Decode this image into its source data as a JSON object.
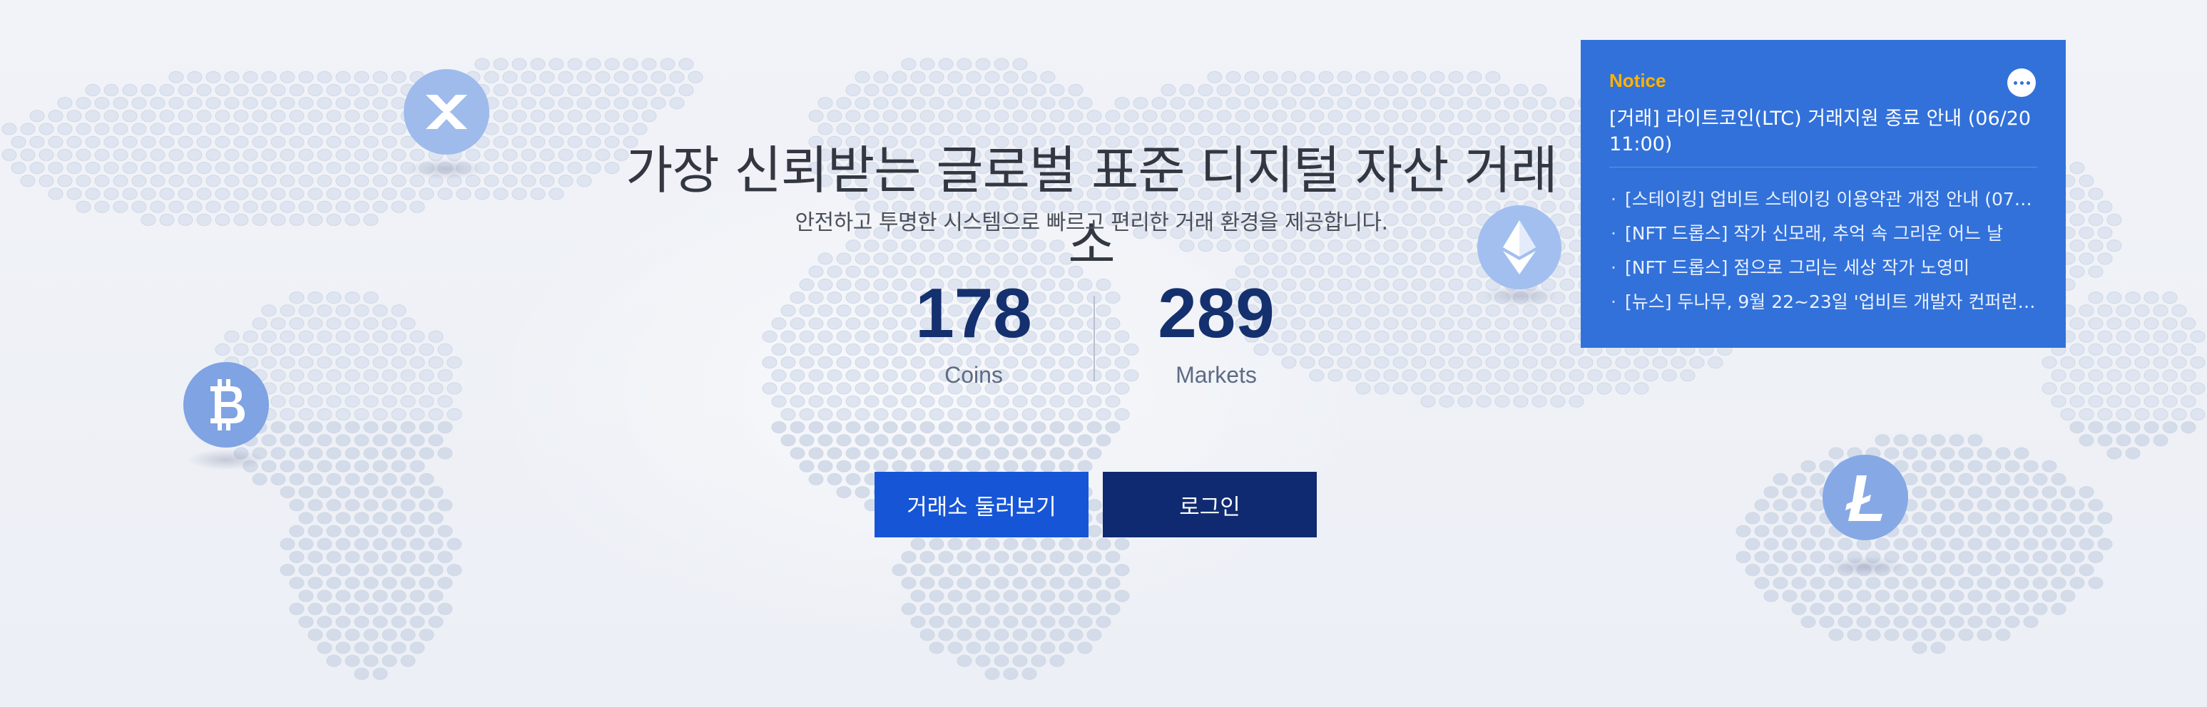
{
  "hero": {
    "headline": "가장 신뢰받는 글로벌 표준 디지털 자산 거래소",
    "subheadline": "안전하고 투명한 시스템으로 빠르고 편리한 거래 환경을 제공합니다."
  },
  "stats": {
    "coins": {
      "value": "178",
      "label": "Coins"
    },
    "markets": {
      "value": "289",
      "label": "Markets"
    }
  },
  "buttons": {
    "explore_label": "거래소 둘러보기",
    "login_label": "로그인"
  },
  "notice": {
    "title": "Notice",
    "headline": "[거래] 라이트코인(LTC) 거래지원 종료 안내 (06/20 11:00)",
    "bullet": "·",
    "items": [
      {
        "text": "[스테이킹] 업비트 스테이킹 이용약관 개정 안내 (07/..."
      },
      {
        "text": "[NFT 드롭스] 작가 신모래, 추억 속 그리운 어느 날"
      },
      {
        "text": "[NFT 드롭스] 점으로 그리는 세상 작가 노영미"
      },
      {
        "text": "[뉴스] 두나무, 9월 22~23일 '업비트 개발자 컨퍼런스 ..."
      }
    ]
  },
  "decor_icons": [
    "world-map",
    "xrp-coin-icon",
    "bitcoin-coin-icon",
    "ethereum-coin-icon",
    "litecoin-coin-icon"
  ],
  "colors": {
    "background": "#eef1f6",
    "stat_value": "#14306e",
    "explore_button": "#1655d6",
    "login_button": "#0f2a70",
    "notice_panel": "#3271d9",
    "notice_title": "#ffb300",
    "coin": "#8fb0e6"
  }
}
